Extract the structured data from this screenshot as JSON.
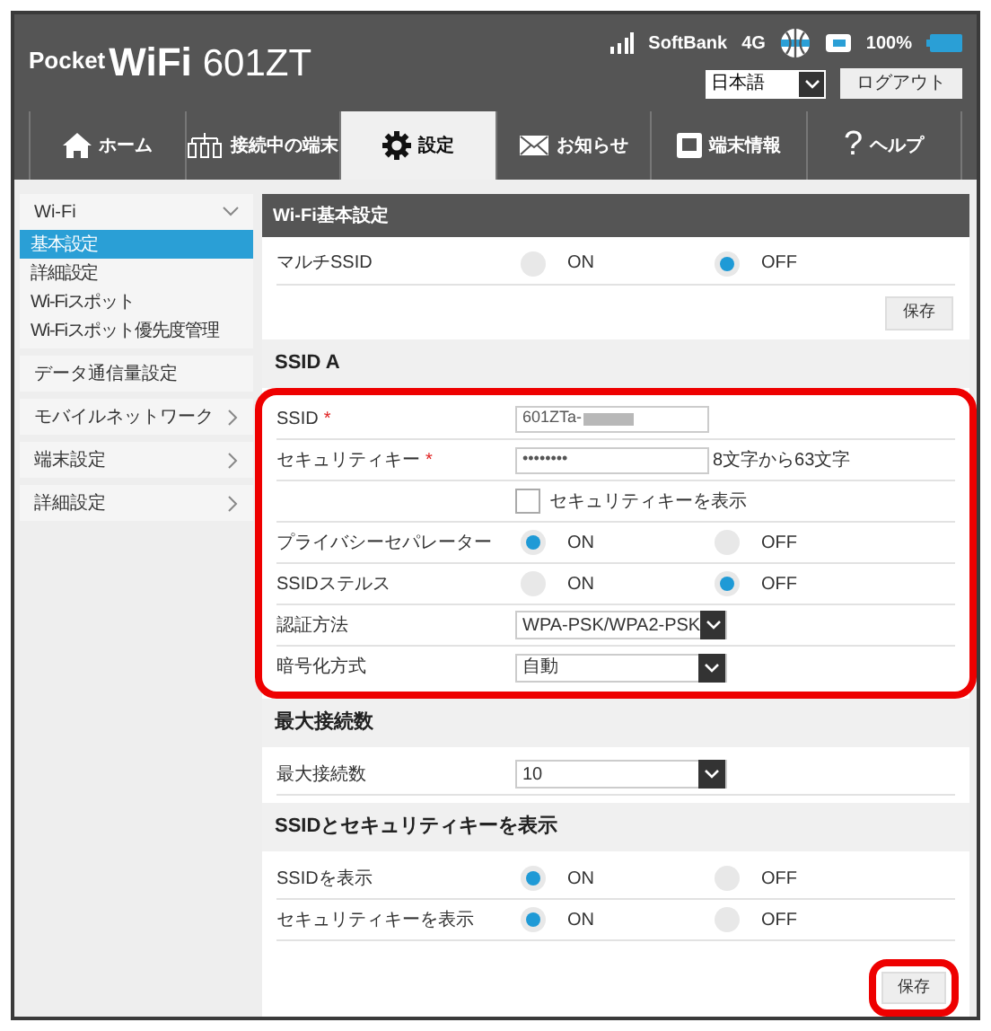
{
  "header": {
    "logo": {
      "prefix": "Pocket",
      "brand": "WiFi",
      "model": "601ZT"
    },
    "status": {
      "carrier": "SoftBank",
      "network": "4G",
      "battery": "100%"
    },
    "language": "日本語",
    "logout": "ログアウト"
  },
  "tabs": [
    {
      "label": "ホーム",
      "kind": "home",
      "selected": false
    },
    {
      "label": "接続中の端末",
      "kind": "devices",
      "selected": false
    },
    {
      "label": "設定",
      "kind": "gear",
      "selected": true
    },
    {
      "label": "お知らせ",
      "kind": "mail",
      "selected": false
    },
    {
      "label": "端末情報",
      "kind": "device",
      "selected": false
    },
    {
      "label": "ヘルプ",
      "kind": "text",
      "icon_text": "?",
      "selected": false
    }
  ],
  "sidebar": [
    {
      "label": "Wi-Fi",
      "kind": "group",
      "expanded": true,
      "children": [
        {
          "label": "基本設定",
          "selected": true
        },
        {
          "label": "詳細設定",
          "selected": false
        },
        {
          "label": "Wi-Fiスポット",
          "selected": false
        },
        {
          "label": "Wi-Fiスポット優先度管理",
          "selected": false
        }
      ]
    },
    {
      "label": "データ通信量設定",
      "kind": "link"
    },
    {
      "label": "モバイルネットワーク",
      "kind": "group",
      "expanded": false
    },
    {
      "label": "端末設定",
      "kind": "group",
      "expanded": false
    },
    {
      "label": "詳細設定",
      "kind": "group",
      "expanded": false
    }
  ],
  "panel": {
    "title": "Wi-Fi基本設定",
    "multi_ssid": {
      "kind": "radio",
      "label": "マルチSSID",
      "options": [
        {
          "label": "ON",
          "selected": false
        },
        {
          "label": "OFF",
          "selected": true
        }
      ]
    },
    "save": "保存",
    "sections": [
      {
        "title": "SSID A",
        "highlighted": true,
        "rows": [
          {
            "kind": "text",
            "label": "SSID",
            "required_mark": "*",
            "value": "601ZTa-",
            "redacted": true
          },
          {
            "kind": "text",
            "label": "セキュリティキー",
            "required_mark": "*",
            "value": "••••••••",
            "hint": "8文字から63文字"
          },
          {
            "kind": "checkbox",
            "text": "セキュリティキーを表示",
            "checked": false
          },
          {
            "kind": "radio",
            "label": "プライバシーセパレーター",
            "options": [
              {
                "label": "ON",
                "selected": true
              },
              {
                "label": "OFF",
                "selected": false
              }
            ]
          },
          {
            "kind": "radio",
            "label": "SSIDステルス",
            "options": [
              {
                "label": "ON",
                "selected": false
              },
              {
                "label": "OFF",
                "selected": true
              }
            ]
          },
          {
            "kind": "select",
            "label": "認証方法",
            "value": "WPA-PSK/WPA2-PSK"
          },
          {
            "kind": "select",
            "label": "暗号化方式",
            "value": "自動"
          }
        ]
      },
      {
        "title": "最大接続数",
        "highlighted": false,
        "rows": [
          {
            "kind": "select",
            "label": "最大接続数",
            "value": "10"
          }
        ]
      },
      {
        "title": "SSIDとセキュリティキーを表示",
        "highlighted": false,
        "rows": [
          {
            "kind": "radio",
            "label": "SSIDを表示",
            "options": [
              {
                "label": "ON",
                "selected": true
              },
              {
                "label": "OFF",
                "selected": false
              }
            ]
          },
          {
            "kind": "radio",
            "label": "セキュリティキーを表示",
            "options": [
              {
                "label": "ON",
                "selected": true
              },
              {
                "label": "OFF",
                "selected": false
              }
            ]
          }
        ]
      }
    ],
    "bottom_save": {
      "label": "保存",
      "highlighted": true
    }
  }
}
